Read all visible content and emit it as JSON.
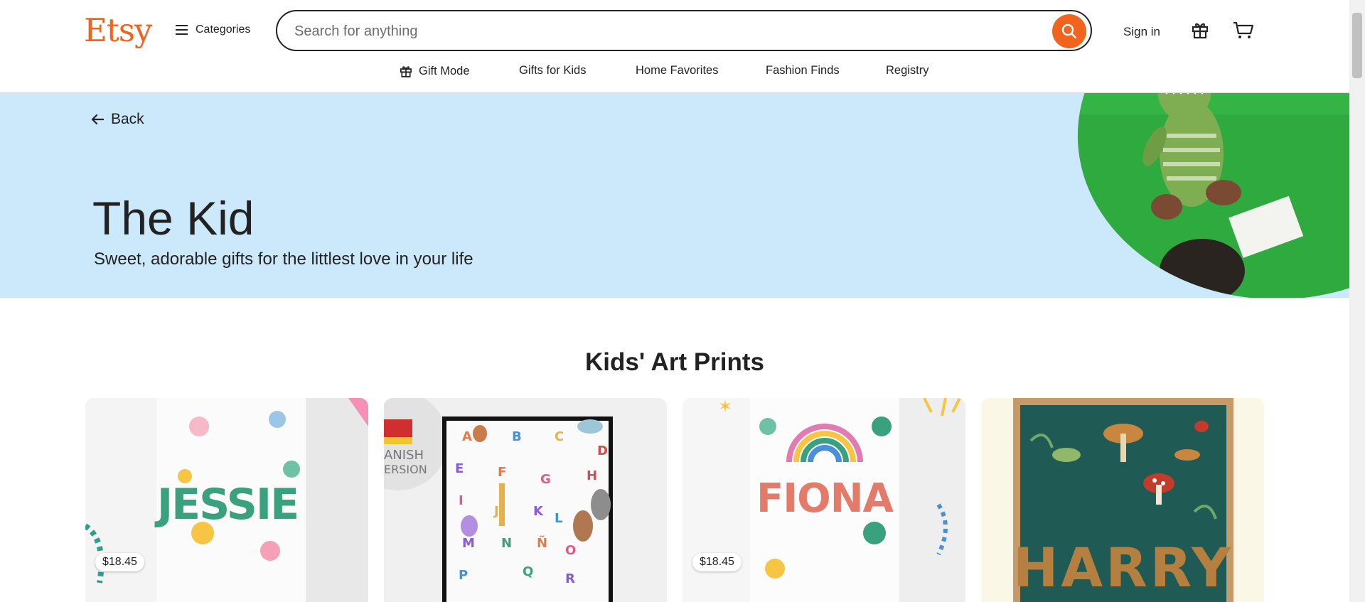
{
  "header": {
    "logo": "Etsy",
    "categories_label": "Categories",
    "search_placeholder": "Search for anything",
    "sign_in_label": "Sign in"
  },
  "subnav": {
    "items": [
      {
        "label": "Gift Mode",
        "icon": "gift-icon"
      },
      {
        "label": "Gifts for Kids"
      },
      {
        "label": "Home Favorites"
      },
      {
        "label": "Fashion Finds"
      },
      {
        "label": "Registry"
      }
    ]
  },
  "banner": {
    "back_label": "Back",
    "title": "The Kid",
    "subtitle": "Sweet, adorable gifts for the littlest love in your life",
    "background_color": "#cce9fb"
  },
  "section": {
    "title": "Kids' Art Prints"
  },
  "products": [
    {
      "name_on_print": "JESSIE",
      "price": "$18.45"
    },
    {
      "overlay_text": "ANISH\nERSION"
    },
    {
      "name_on_print": "FIONA",
      "price": "$18.45"
    },
    {
      "name_on_print": "HARRY"
    }
  ],
  "colors": {
    "brand": "#f1641e",
    "text": "#222222"
  }
}
